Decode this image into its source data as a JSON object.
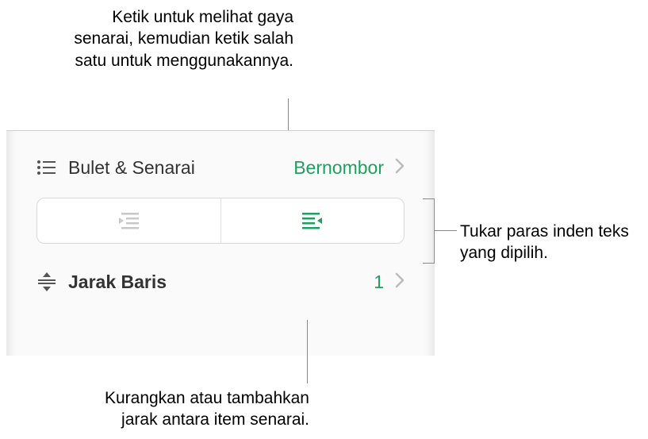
{
  "callouts": {
    "top": "Ketik untuk melihat gaya senarai, kemudian ketik salah satu untuk menggunakannya.",
    "right": "Tukar paras inden teks yang dipilih.",
    "bottom": "Kurangkan atau tambahkan jarak antara item senarai."
  },
  "panel": {
    "bullets": {
      "label": "Bulet & Senarai",
      "value": "Bernombor"
    },
    "spacing": {
      "label": "Jarak Baris",
      "value": "1"
    }
  },
  "colors": {
    "accent": "#1fa060"
  }
}
